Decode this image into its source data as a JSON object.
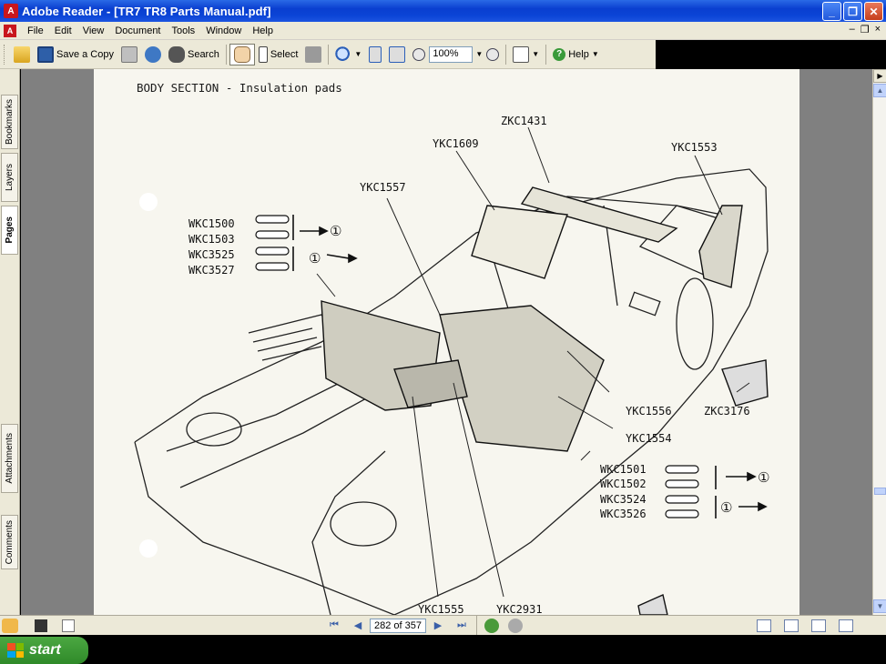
{
  "window": {
    "title": "Adobe Reader - [TR7 TR8 Parts Manual.pdf]",
    "buttons": {
      "minimize": "_",
      "restore": "❐",
      "close": "✕"
    }
  },
  "menu": {
    "items": [
      "File",
      "Edit",
      "View",
      "Document",
      "Tools",
      "Window",
      "Help"
    ],
    "mdi": {
      "minimize": "–",
      "restore": "❐",
      "close": "×"
    }
  },
  "toolbar": {
    "save_copy": "Save a Copy",
    "search": "Search",
    "select": "Select",
    "zoom": "100%",
    "help": "Help"
  },
  "nav_panel": {
    "tabs": [
      "Bookmarks",
      "Layers",
      "Pages",
      "Attachments",
      "Comments"
    ]
  },
  "document": {
    "heading": "BODY SECTION - Insulation pads",
    "callouts": {
      "zkc1431": "ZKC1431",
      "ykc1609": "YKC1609",
      "ykc1553": "YKC1553",
      "ykc1557": "YKC1557",
      "ykc1556": "YKC1556",
      "zkc3176": "ZKC3176",
      "ykc1554": "YKC1554",
      "ykc1555": "YKC1555",
      "ykc2931": "YKC2931"
    },
    "left_parts": [
      "WKC1500",
      "WKC1503",
      "WKC3525",
      "WKC3527"
    ],
    "right_parts": [
      "WKC1501",
      "WKC1502",
      "WKC3524",
      "WKC3526"
    ],
    "ref_marker": "①"
  },
  "status": {
    "page_count": "282 of 357"
  },
  "taskbar": {
    "start": "start"
  }
}
